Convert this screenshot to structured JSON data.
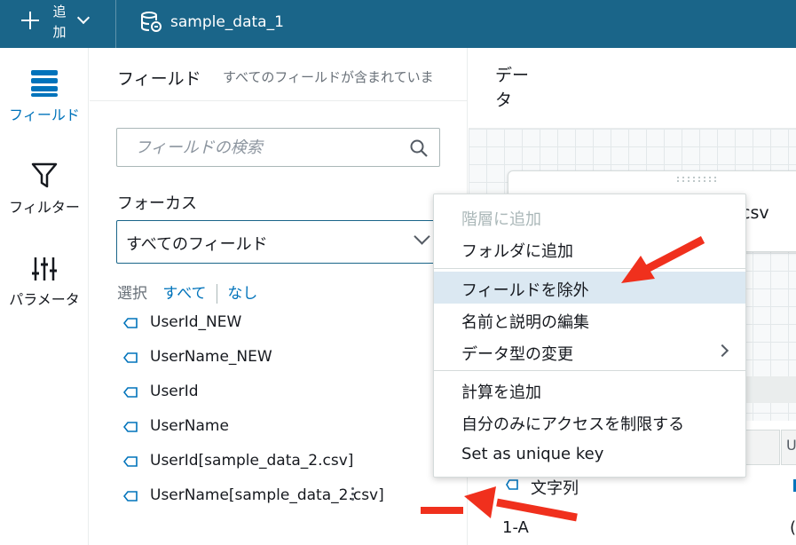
{
  "topbar": {
    "add_label": "追加",
    "dataset_name": "sample_data_1"
  },
  "rail": {
    "fields_label": "フィールド",
    "filter_label": "フィルター",
    "params_label": "パラメータ"
  },
  "panel": {
    "title": "フィールド",
    "subtitle": "すべてのフィールドが含まれていま",
    "search_placeholder": "フィールドの検索",
    "focus_label": "フォーカス",
    "focus_value": "すべてのフィールド",
    "select_label": "選択",
    "select_all": "すべて",
    "select_none": "なし",
    "fields": [
      {
        "name": "UserId_NEW"
      },
      {
        "name": "UserName_NEW"
      },
      {
        "name": "UserId"
      },
      {
        "name": "UserName"
      },
      {
        "name": "UserId[sample_data_2.csv]"
      },
      {
        "name": "UserName[sample_data_2.csv]"
      }
    ]
  },
  "data_area": {
    "title": "データ",
    "node_label": "csv",
    "column_header_partial": "U",
    "type_label": "文字列",
    "row_value": "1-A",
    "row_value_right": "("
  },
  "context_menu": {
    "items": [
      {
        "label": "階層に追加",
        "disabled": true
      },
      {
        "label": "フォルダに追加"
      },
      {
        "label": "フィールドを除外",
        "highlighted": true
      },
      {
        "label": "名前と説明の編集"
      },
      {
        "label": "データ型の変更",
        "submenu": true
      },
      {
        "label": "計算を追加"
      },
      {
        "label": "自分のみにアクセスを制限する"
      },
      {
        "label": "Set as unique key"
      }
    ]
  },
  "colors": {
    "topbar": "#1a6589",
    "accent_blue": "#0073bb",
    "highlight": "#dbe8f2",
    "annotation_red": "#f0301d"
  }
}
